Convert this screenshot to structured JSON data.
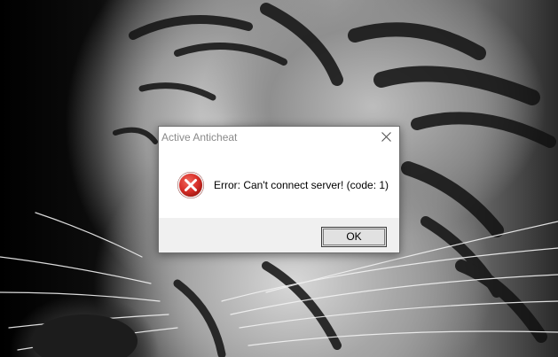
{
  "dialog": {
    "title": "Active Anticheat",
    "message": "Error: Can't connect server! (code: 1)",
    "ok_label": "OK"
  },
  "icons": {
    "error": "error-icon",
    "close": "close-icon"
  },
  "colors": {
    "error_red": "#d9302a",
    "footer_bg": "#f0f0f0"
  }
}
